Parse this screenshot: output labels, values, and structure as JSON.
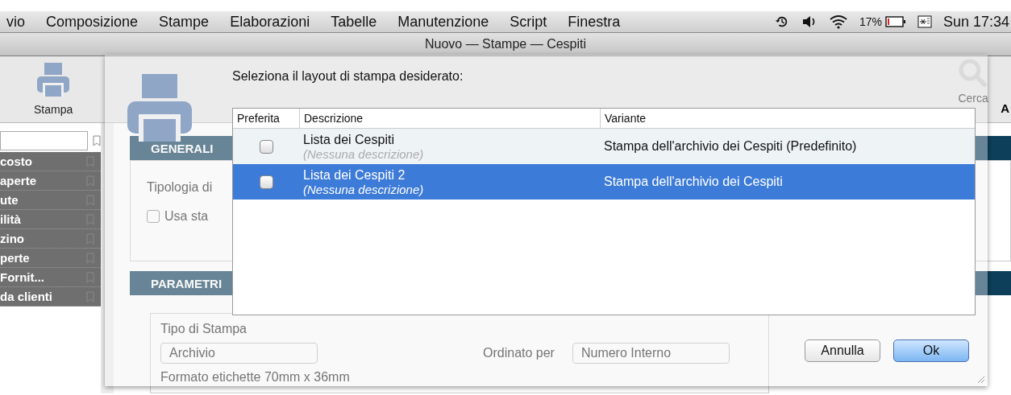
{
  "menu_bar": {
    "items": [
      "vio",
      "Composizione",
      "Stampe",
      "Elaborazioni",
      "Tabelle",
      "Manutenzione",
      "Script",
      "Finestra"
    ],
    "battery_percent": "17%",
    "clock": "Sun 17:34"
  },
  "window": {
    "title": "Nuovo — Stampe — Cespiti"
  },
  "toolbar": {
    "print_button": "Stampa",
    "search_button": "Cerca",
    "column_3": "A"
  },
  "sidebar": {
    "items": [
      "costo",
      "aperte",
      "ute",
      "ilità",
      "zino",
      "perte",
      "Fornit...",
      "da clienti"
    ]
  },
  "form": {
    "general_title": "GENERALI",
    "print_type_label": "Tipologia di",
    "use_preferred": {
      "label": "Usa sta",
      "checked": false
    },
    "parameters_title": "PARAMETRI",
    "print_kind_label": "Tipo di Stampa",
    "print_kind_value": "Archivio",
    "order_label": "Ordinato per",
    "order_value": "Numero Interno",
    "label_format": "Formato etichette 70mm x 36mm"
  },
  "dialog": {
    "prompt": "Seleziona il layout di stampa desiderato:",
    "columns": [
      "Preferita",
      "Descrizione",
      "Variante"
    ],
    "rows": [
      {
        "name": "Lista dei Cespiti",
        "description": "(Nessuna descrizione)",
        "variant": "Stampa dell'archivio dei Cespiti (Predefinito)",
        "checked": false,
        "selected": false
      },
      {
        "name": "Lista dei Cespiti 2",
        "description": "(Nessuna descrizione)",
        "variant": "Stampa dell'archivio dei Cespiti",
        "checked": false,
        "selected": true
      }
    ],
    "buttons": [
      {
        "label": "Annulla",
        "default": false
      },
      {
        "label": "Ok",
        "default": true
      }
    ]
  }
}
